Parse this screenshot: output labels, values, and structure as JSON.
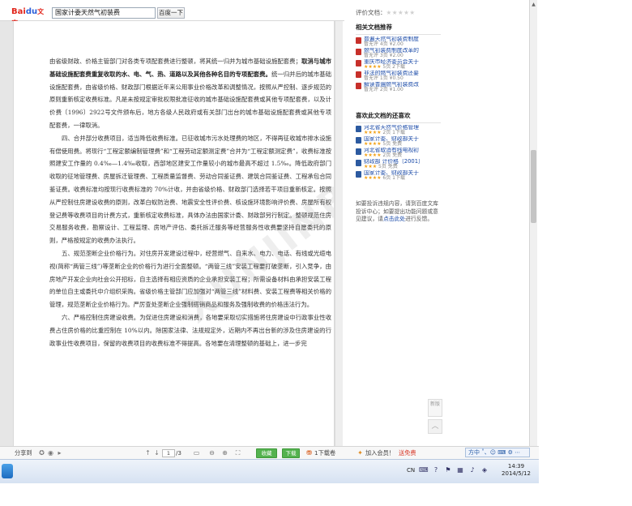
{
  "header": {
    "logo_part1": "Bai",
    "logo_part2": "du",
    "logo_part3": "文库",
    "search_value": "国家计委天然气初装费",
    "search_button": "百度一下"
  },
  "document": {
    "paragraphs": [
      {
        "indent": false,
        "parts": [
          {
            "b": false,
            "t": "由省级财政、价格主管部门对各类专项配套费进行整顿，将其统一归并为城市基础设施配套费；"
          },
          {
            "b": true,
            "t": "取消与城市基础设施配套费重复收取的水、电、气、热、道路以及其他各种名目的专项配套费。"
          },
          {
            "b": false,
            "t": "统一归并后的城市基础设施配套费，由省级价格、财政部门根据近年来公用事业价格改革和调整情况，按照从严控制、逐步规范的原则重新核定收费标准。凡是未按规定审批权限批准征收的城市基础设施配套费或其他专项配套费，以及计价费〔1996〕2922号文件颁布后，地方各级人民政府或有关部门出台的城市基础设施配套费或其他专项配套费，一律取消。"
          }
        ]
      },
      {
        "indent": true,
        "parts": [
          {
            "b": false,
            "t": "四、合并部分收费项目，适当降低收费标准。已征收城市污水处理费的地区，不得再征收城市排水设施有偿使用费。将现行“工程定额编制管理费”和“工程劳动定额测定费”合并为“工程定额测定费”，收费标准按照建安工作量的 0.4‰—1.4‰收取，西部地区建安工作量较小的城市最高不超过 1.5‰。降低政府部门收取的征地管理费、房屋拆迁管理费、工程质量监督费、劳动合同鉴证费、建筑合同鉴证费、工程承包合同鉴证费。收费标准均按现行收费标准的 70%计收，并由省级价格、财政部门选择若干项目重新核定。按照从严控制住房建设收费的原则，改革白蚁防治费、地震安全性评价费、核设施环境影响评价费、房屋所有权登记费等收费项目的计费方式，重新核定收费标准，具体办法由国家计委、财政部另行制定。整顿规范住房交易服务收费，勘察设计、工程监理、房地产评估、委托拆迁服务等经营服务性收费要坚持自愿委托的原则，严格按规定的收费办法执行。"
          }
        ]
      },
      {
        "indent": true,
        "parts": [
          {
            "b": false,
            "t": "五、规范垄断企业价格行为。对住房开发建设过程中，经营燃气、自来水、电力、电话、有线或光缆电视(简称“两管三线”)等垄断企业的价格行为进行全面整顿。“两管三线”安装工程要打破垄断，引入竞争，由房地产开发企业向社会公开招标，自主选择有相应资质的企业承担安装工程；所需设备材料由承担安装工程的单位自主或委托中介组织采购。省级价格主管部门应加强对“两管三线”材料费、安装工程费等相关价格的管理，规范垄断企业价格行为。严厉查处垄断企业强制搭销商品和服务及强制收费的价格违法行为。"
          }
        ]
      },
      {
        "indent": true,
        "parts": [
          {
            "b": false,
            "t": "六、严格控制住房建设收费。为促进住房建设和消费，各地要采取切实措施将住房建设中行政事业性收费占住房价格的比重控制在 10%以内。除国家法律、法规规定外，近期内不再出台新的涉及住房建设的行政事业性收费项目，保留的收费项目的收费标准不得提高。各地要在清理整顿的基础上，进一步完"
          }
        ]
      }
    ],
    "watermark": "XUNJINBIDS"
  },
  "sidebar": {
    "rating_label": "评价文档：",
    "rating_stars": "★★★★★",
    "related_title": "相关文档推荐",
    "related": [
      {
        "type": "pdf",
        "title": "普遍天然气初装费制度",
        "meta_stars": "",
        "meta": "暂无评  4页 ¥2.00"
      },
      {
        "type": "pdf",
        "title": "燃气初装费制度改革的",
        "meta_stars": "",
        "meta": "暂无评  3页 ¥2.00"
      },
      {
        "type": "pdf",
        "title": "重庆市经济委员会关于",
        "meta_stars": "★★★★",
        "meta": " 5页 2下载"
      },
      {
        "type": "pdf",
        "title": "非法的燃气初装费还要",
        "meta_stars": "",
        "meta": "暂无评  1页 ¥0.50"
      },
      {
        "type": "pdf",
        "title": "解读普遍燃气初装费改",
        "meta_stars": "",
        "meta": "暂无评  2页 ¥1.00"
      }
    ],
    "also_title": "喜欢此文档的还喜欢",
    "also": [
      {
        "type": "word",
        "title": "河北省天然气价格管理",
        "meta_stars": "★★★★",
        "meta": " 2页 1下载"
      },
      {
        "type": "word",
        "title": "国家计委、财政部关于",
        "meta_stars": "★★★★",
        "meta": " 5页 免费"
      },
      {
        "type": "word",
        "title": "河北省取消有线电视初",
        "meta_stars": "★★★★",
        "meta": " 2页 免费"
      },
      {
        "type": "word",
        "title": "财政部 计价格〔2001〕",
        "meta_stars": "★★★",
        "meta": " 5页 免费"
      },
      {
        "type": "word",
        "title": "国家计委、财政部关于",
        "meta_stars": "★★★★",
        "meta": " 6页 1下载"
      }
    ],
    "feedback_1": "如要投诉违规内容，请到百度文库投诉中心；如要提出功能问题或意见建议，请",
    "feedback_link": "点击此处",
    "feedback_2": "进行反馈。",
    "new_version": "新版",
    "back_to_top": "︿"
  },
  "toolbar": {
    "share_label": "分享到",
    "page_current": "1",
    "page_total": "/3",
    "collect_label": "收藏",
    "download_label": "下载",
    "download_count": "1下载卷",
    "vip_prefix": "加入会员！",
    "vip_text": "送免费"
  },
  "ime": {
    "text": "方中 ˚、☺ ⌨ ⚙ ⋯"
  },
  "taskbar": {
    "lang": "CN",
    "time": "14:39",
    "date": "2014/5/12"
  }
}
